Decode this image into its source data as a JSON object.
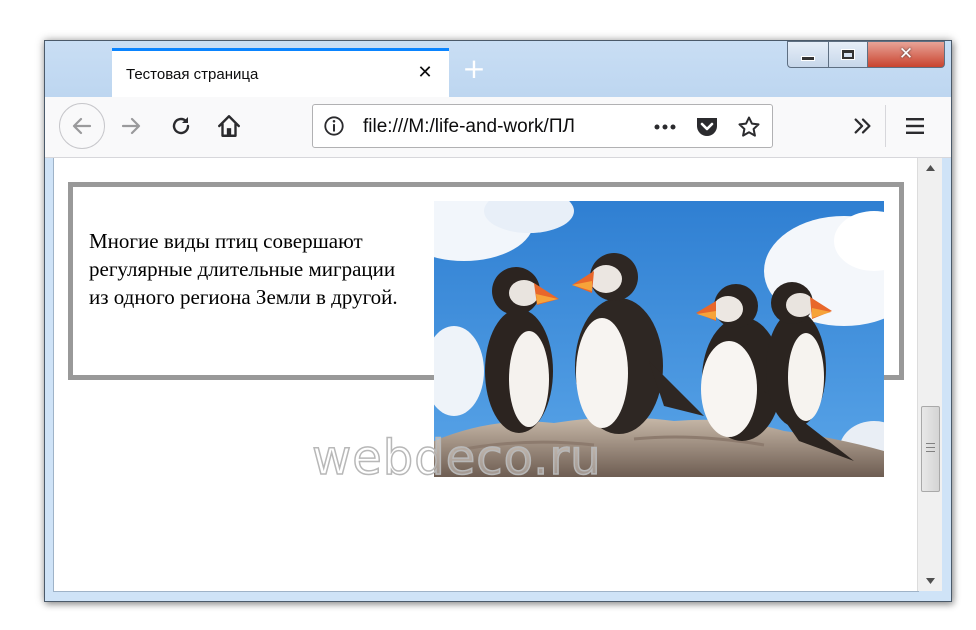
{
  "browser": {
    "tab": {
      "title": "Тестовая страница",
      "close_symbol": "✕"
    },
    "new_tab_symbol": "+",
    "window_controls": {
      "minimize": "minimize-icon",
      "maximize": "maximize-icon",
      "close": "close-icon",
      "close_symbol": "✕"
    },
    "toolbar": {
      "back": "back-arrow-icon",
      "forward": "forward-arrow-icon",
      "reload": "reload-icon",
      "home": "home-icon",
      "url": "file:///M:/life-and-work/ПЛ",
      "page_actions": [
        "more-dots-icon",
        "pocket-icon",
        "bookmark-star-icon"
      ],
      "overflow": "double-chevron-icon",
      "menu": "hamburger-menu-icon"
    }
  },
  "page": {
    "paragraph": "Многие виды птиц совершают регулярные длительные миграции из одного региона Земли в другой.",
    "image": "puffins-photo",
    "watermark": "webdeco.ru"
  },
  "colors": {
    "tab_accent": "#0a84ff",
    "frame_border": "#999999",
    "close_button": "#c9442f"
  }
}
